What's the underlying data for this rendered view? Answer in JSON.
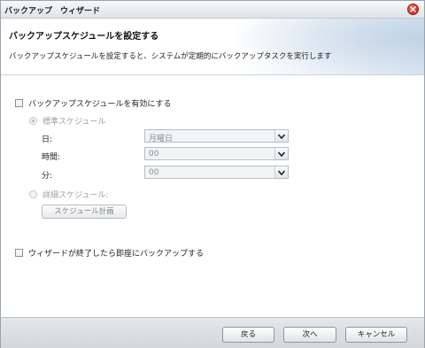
{
  "window": {
    "title": "バックアップ　ウィザード"
  },
  "banner": {
    "heading": "バックアップスケジュールを設定する",
    "description": "バックアップスケジュールを設定すると、システムが定期的にバックアップタスクを実行します"
  },
  "options": {
    "enable_schedule": {
      "label": "バックアップスケジュールを有効にする",
      "checked": false
    },
    "standard_schedule": {
      "label": "標準スケジュール",
      "selected": true,
      "enabled": false
    },
    "fields": {
      "day": {
        "label": "日:",
        "value": "月曜日"
      },
      "hour": {
        "label": "時間:",
        "value": "00"
      },
      "minute": {
        "label": "分:",
        "value": "00"
      }
    },
    "detailed_schedule": {
      "label": "詳細スケジュール:",
      "selected": false,
      "enabled": false
    },
    "schedule_button": "スケジュール計画",
    "backup_now": {
      "label": "ウィザードが終了したら即座にバックアップする",
      "checked": false
    }
  },
  "footer": {
    "back": "戻る",
    "next": "次へ",
    "cancel": "キャンセル"
  },
  "icons": {
    "close": "close-icon",
    "dropdown": "chevron-down-icon"
  },
  "colors": {
    "close": "#d2281c",
    "disabled_text": "#9a9ea3",
    "footer_bg": "#dbe0e5"
  }
}
